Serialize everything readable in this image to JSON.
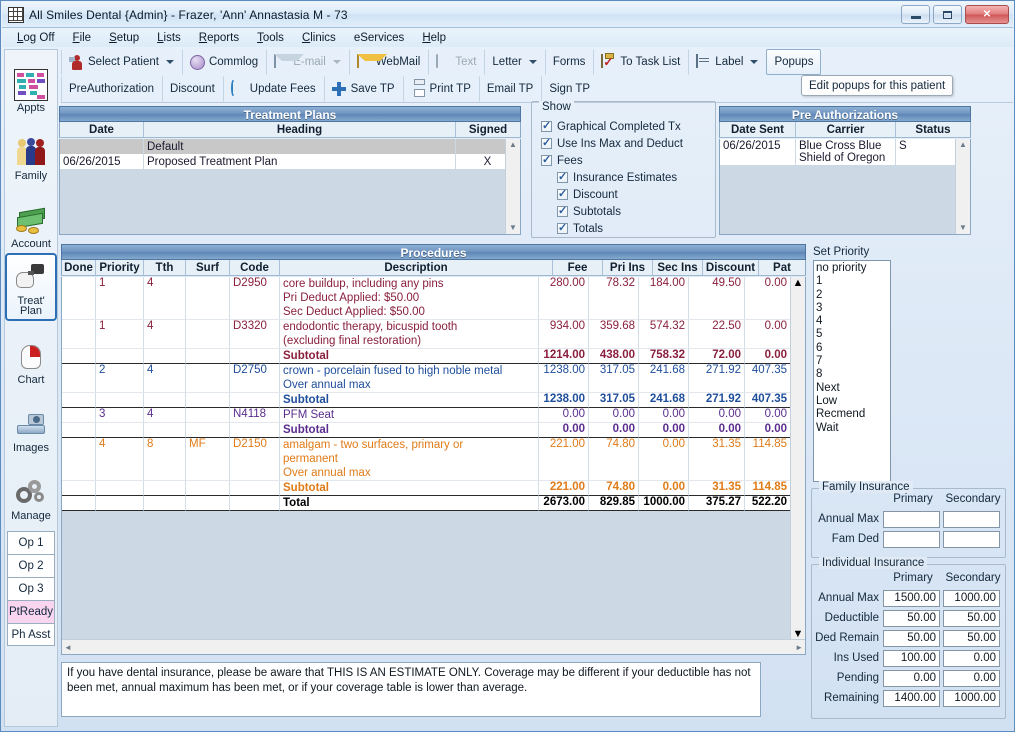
{
  "window": {
    "title": "All Smiles Dental {Admin} - Frazer, 'Ann' Annastasia M - 73",
    "minimize_label": "Minimize",
    "maximize_label": "Maximize",
    "close_label": "✕"
  },
  "menu": {
    "items": [
      "Log Off",
      "File",
      "Setup",
      "Lists",
      "Reports",
      "Tools",
      "Clinics",
      "eServices",
      "Help"
    ]
  },
  "toolbar_top": {
    "select_patient": "Select Patient",
    "commlog": "Commlog",
    "email": "E-mail",
    "webmail": "WebMail",
    "text": "Text",
    "letter": "Letter",
    "forms": "Forms",
    "to_task_list": "To Task List",
    "label": "Label",
    "popups": "Popups"
  },
  "toolbar_second": {
    "preauthorization": "PreAuthorization",
    "discount": "Discount",
    "update_fees": "Update Fees",
    "save_tp": "Save TP",
    "print_tp": "Print TP",
    "email_tp": "Email TP",
    "sign_tp": "Sign TP"
  },
  "tooltip": {
    "text": "Edit popups for this patient"
  },
  "left_nav": {
    "items": [
      {
        "label": "Appts",
        "icon": "calendar-icon"
      },
      {
        "label": "Family",
        "icon": "family-icon"
      },
      {
        "label": "Account",
        "icon": "money-icon"
      },
      {
        "label": "Treat'\nPlan",
        "label_line1": "Treat'",
        "label_line2": "Plan",
        "icon": "tooth-drill-icon"
      },
      {
        "label": "Chart",
        "icon": "tooth-icon"
      },
      {
        "label": "Images",
        "icon": "scanner-icon"
      },
      {
        "label": "Manage",
        "icon": "gears-icon"
      }
    ],
    "selected": "Treat' Plan",
    "op_buttons": [
      "Op 1",
      "Op 2",
      "Op 3",
      "PtReady",
      "Ph Asst"
    ],
    "highlighted_op": "PtReady"
  },
  "treatment_plans": {
    "title": "Treatment Plans",
    "columns": [
      "Date",
      "Heading",
      "Signed"
    ],
    "rows": [
      {
        "date": "",
        "heading": "Default",
        "signed": "",
        "style": "grey"
      },
      {
        "date": "06/26/2015",
        "heading": "Proposed Treatment Plan",
        "signed": "X",
        "style": "white"
      }
    ]
  },
  "show": {
    "legend": "Show",
    "options": [
      {
        "label": "Graphical Completed Tx",
        "checked": true,
        "indent": 0
      },
      {
        "label": "Use Ins Max and Deduct",
        "checked": true,
        "indent": 0
      },
      {
        "label": "Fees",
        "checked": true,
        "indent": 0
      },
      {
        "label": "Insurance Estimates",
        "checked": true,
        "indent": 1
      },
      {
        "label": "Discount",
        "checked": true,
        "indent": 1
      },
      {
        "label": "Subtotals",
        "checked": true,
        "indent": 1
      },
      {
        "label": "Totals",
        "checked": true,
        "indent": 1
      }
    ]
  },
  "pre_authorizations": {
    "title": "Pre Authorizations",
    "columns": [
      "Date Sent",
      "Carrier",
      "Status"
    ],
    "rows": [
      {
        "date_sent": "06/26/2015",
        "carrier": "Blue Cross Blue Shield of Oregon",
        "status": "S"
      }
    ]
  },
  "procedures": {
    "title": "Procedures",
    "columns": [
      "Done",
      "Priority",
      "Tth",
      "Surf",
      "Code",
      "Description",
      "Fee",
      "Pri Ins",
      "Sec Ins",
      "Discount",
      "Pat"
    ],
    "rows": [
      {
        "type": "proc",
        "color": "maroon",
        "done": "",
        "priority": "1",
        "tth": "4",
        "surf": "",
        "code": "D2950",
        "description": [
          "core buildup, including any pins",
          "Pri Deduct Applied: $50.00",
          "Sec Deduct Applied: $50.00"
        ],
        "fee": "280.00",
        "pri_ins": "78.32",
        "sec_ins": "184.00",
        "discount": "49.50",
        "pat": "0.00"
      },
      {
        "type": "proc",
        "color": "maroon",
        "done": "",
        "priority": "1",
        "tth": "4",
        "surf": "",
        "code": "D3320",
        "description": [
          "endodontic therapy, bicuspid tooth",
          "(excluding final restoration)"
        ],
        "fee": "934.00",
        "pri_ins": "359.68",
        "sec_ins": "574.32",
        "discount": "22.50",
        "pat": "0.00"
      },
      {
        "type": "subtotal",
        "color": "maroon",
        "description": [
          "Subtotal"
        ],
        "fee": "1214.00",
        "pri_ins": "438.00",
        "sec_ins": "758.32",
        "discount": "72.00",
        "pat": "0.00"
      },
      {
        "type": "proc",
        "color": "blue",
        "done": "",
        "priority": "2",
        "tth": "4",
        "surf": "",
        "code": "D2750",
        "description": [
          "crown - porcelain fused to high noble metal",
          "Over annual max"
        ],
        "fee": "1238.00",
        "pri_ins": "317.05",
        "sec_ins": "241.68",
        "discount": "271.92",
        "pat": "407.35"
      },
      {
        "type": "subtotal",
        "color": "blue",
        "description": [
          "Subtotal"
        ],
        "fee": "1238.00",
        "pri_ins": "317.05",
        "sec_ins": "241.68",
        "discount": "271.92",
        "pat": "407.35"
      },
      {
        "type": "proc",
        "color": "purple",
        "done": "",
        "priority": "3",
        "tth": "4",
        "surf": "",
        "code": "N4118",
        "description": [
          "PFM Seat"
        ],
        "fee": "0.00",
        "pri_ins": "0.00",
        "sec_ins": "0.00",
        "discount": "0.00",
        "pat": "0.00"
      },
      {
        "type": "subtotal",
        "color": "purple",
        "description": [
          "Subtotal"
        ],
        "fee": "0.00",
        "pri_ins": "0.00",
        "sec_ins": "0.00",
        "discount": "0.00",
        "pat": "0.00"
      },
      {
        "type": "proc",
        "color": "orange",
        "done": "",
        "priority": "4",
        "tth": "8",
        "surf": "MF",
        "code": "D2150",
        "description": [
          "amalgam - two surfaces, primary or",
          "permanent",
          "Over annual max"
        ],
        "fee": "221.00",
        "pri_ins": "74.80",
        "sec_ins": "0.00",
        "discount": "31.35",
        "pat": "114.85"
      },
      {
        "type": "subtotal",
        "color": "orange",
        "description": [
          "Subtotal"
        ],
        "fee": "221.00",
        "pri_ins": "74.80",
        "sec_ins": "0.00",
        "discount": "31.35",
        "pat": "114.85"
      },
      {
        "type": "total",
        "color": "black",
        "description": [
          "Total"
        ],
        "fee": "2673.00",
        "pri_ins": "829.85",
        "sec_ins": "1000.00",
        "discount": "375.27",
        "pat": "522.20"
      }
    ],
    "row_colors": {
      "maroon": "#8a1f3d",
      "blue": "#1f4e9c",
      "purple": "#5b2d8e",
      "orange": "#e07b18",
      "black": "#000000"
    }
  },
  "set_priority": {
    "label": "Set Priority",
    "options": [
      "no priority",
      "1",
      "2",
      "3",
      "4",
      "5",
      "6",
      "7",
      "8",
      "Next",
      "Low",
      "Recmend",
      "Wait"
    ]
  },
  "family_insurance": {
    "legend": "Family Insurance",
    "col_primary": "Primary",
    "col_secondary": "Secondary",
    "rows": [
      {
        "label": "Annual Max",
        "primary": "",
        "secondary": ""
      },
      {
        "label": "Fam Ded",
        "primary": "",
        "secondary": ""
      }
    ]
  },
  "individual_insurance": {
    "legend": "Individual Insurance",
    "col_primary": "Primary",
    "col_secondary": "Secondary",
    "rows": [
      {
        "label": "Annual Max",
        "primary": "1500.00",
        "secondary": "1000.00"
      },
      {
        "label": "Deductible",
        "primary": "50.00",
        "secondary": "50.00"
      },
      {
        "label": "Ded Remain",
        "primary": "50.00",
        "secondary": "50.00"
      },
      {
        "label": "Ins Used",
        "primary": "100.00",
        "secondary": "0.00"
      },
      {
        "label": "Pending",
        "primary": "0.00",
        "secondary": "0.00"
      },
      {
        "label": "Remaining",
        "primary": "1400.00",
        "secondary": "1000.00"
      }
    ]
  },
  "disclaimer": {
    "text": "If you have dental insurance, please be aware that THIS IS AN ESTIMATE ONLY.  Coverage may be different if your deductible has not been met, annual maximum has been met, or if your coverage table is lower than average."
  }
}
